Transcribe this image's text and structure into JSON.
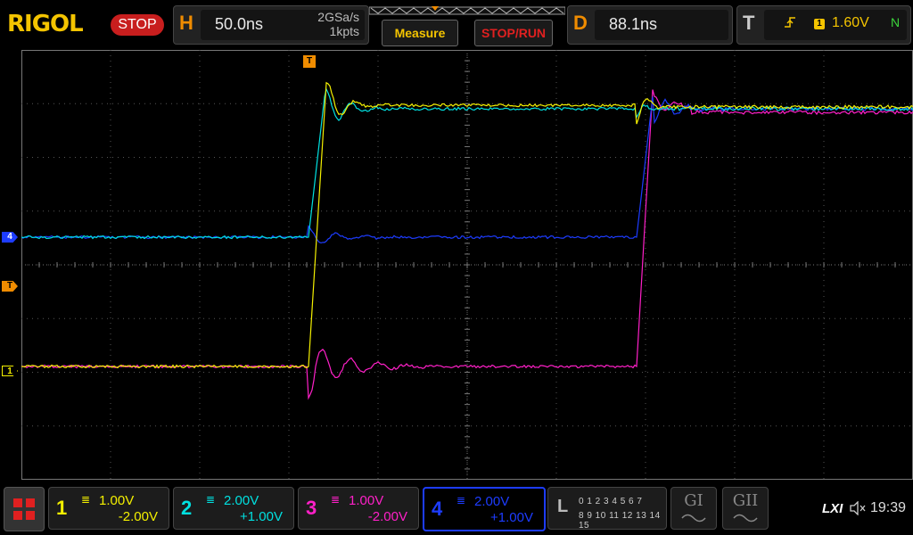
{
  "brand": {
    "logo": "RIGOL",
    "status": "STOP"
  },
  "horizontal": {
    "key": "H",
    "timebase": "50.0ns",
    "sample_rate": "2GSa/s",
    "memory_depth": "1kpts"
  },
  "buttons": {
    "measure": "Measure",
    "stop_run": "STOP/RUN"
  },
  "delay": {
    "key": "D",
    "value": "88.1ns"
  },
  "trigger": {
    "key": "T",
    "edge_icon": "rising-edge-icon",
    "source": "1",
    "level": "1.60V",
    "mode": "N"
  },
  "markers": {
    "trigger_top": "T",
    "trigger_level": "T",
    "ch1": "1",
    "ch4": "4"
  },
  "channels": [
    {
      "num": "1",
      "scale": "1.00V",
      "offset": "-2.00V",
      "color": "#f4f000",
      "active": false
    },
    {
      "num": "2",
      "scale": "2.00V",
      "offset": "+1.00V",
      "color": "#00e0e0",
      "active": false
    },
    {
      "num": "3",
      "scale": "1.00V",
      "offset": "-2.00V",
      "color": "#ff20c8",
      "active": false
    },
    {
      "num": "4",
      "scale": "2.00V",
      "offset": "+1.00V",
      "color": "#1d3cff",
      "active": true
    }
  ],
  "logic": {
    "key": "L",
    "row1": "0 1 2 3   4 5 6 7",
    "row2": "8 9 10 11 12 13 14 15"
  },
  "generators": [
    {
      "label": "GI"
    },
    {
      "label": "GII"
    }
  ],
  "status_bar": {
    "lxi": "LXI",
    "speaker_icon": "speaker-muted-icon",
    "time": "19:39"
  },
  "colors": {
    "accent_orange": "#f08c00",
    "grid": "#555555"
  }
}
